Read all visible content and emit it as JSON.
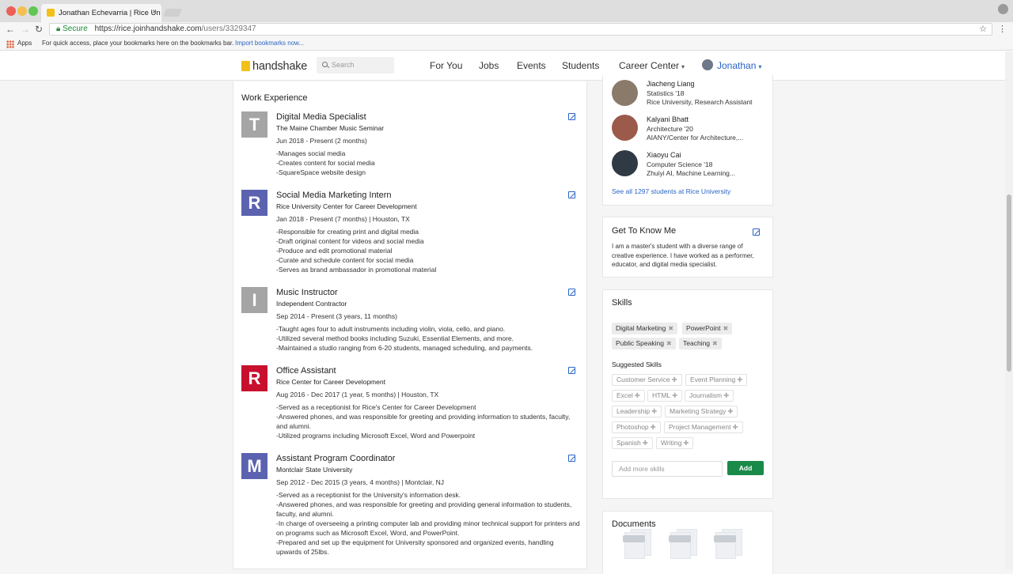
{
  "browser": {
    "tab_title": "Jonathan Echevarria | Rice Un",
    "tab_close": "×",
    "secure_label": "Secure",
    "url_host": "https://rice.joinhandshake.com",
    "url_path": "/users/3329347",
    "back": "←",
    "forward": "→",
    "reload": "↻",
    "star": "☆",
    "menu": "⋮",
    "bookmarks": {
      "apps_label": "Apps",
      "hint": "For quick access, place your bookmarks here on the bookmarks bar.",
      "import_link": "Import bookmarks now..."
    }
  },
  "header": {
    "logo": "handshake",
    "search_placeholder": "Search",
    "nav": [
      "For You",
      "Jobs",
      "Events",
      "Students",
      "Career Center"
    ],
    "user_name": "Jonathan",
    "caret": "▾"
  },
  "work_experience": {
    "title": "Work Experience",
    "jobs": [
      {
        "logo_letter": "T",
        "logo_color": "#a5a5a5",
        "title": "Digital Media Specialist",
        "org": "The Maine Chamber Music Seminar",
        "dates": "Jun 2018 - Present (2 months)",
        "description": [
          "-Manages social media",
          "-Creates content for social media",
          "-SquareSpace website design"
        ]
      },
      {
        "logo_letter": "R",
        "logo_color": "#5b63b0",
        "title": "Social Media Marketing Intern",
        "org": "Rice University Center for Career Development",
        "dates": "Jan 2018 - Present (7 months) | Houston, TX",
        "description": [
          "-Responsible for creating print and digital media",
          "-Draft original content for videos and social media",
          "-Produce and edit promotional material",
          "-Curate and schedule content for social media",
          "-Serves as brand ambassador in promotional material"
        ]
      },
      {
        "logo_letter": "I",
        "logo_color": "#a5a5a5",
        "title": "Music Instructor",
        "org": "Independent Contractor",
        "dates": "Sep 2014 - Present (3 years, 11 months)",
        "description": [
          "-Taught ages four to adult instruments including violin, viola, cello, and piano.",
          "-Utilized several method books including Suzuki, Essential Elements, and more.",
          "-Maintained a studio ranging from 6-20 students, managed scheduling, and payments."
        ]
      },
      {
        "logo_letter": "R",
        "logo_color": "#c8102e",
        "title": "Office Assistant",
        "org": "Rice Center for Career Development",
        "dates": "Aug 2016 - Dec 2017 (1 year, 5 months) | Houston, TX",
        "description": [
          "-Served as a receptionist for Rice's Center for Career Development",
          "-Answered phones, and was responsible for greeting and providing information to students, faculty, and alumni.",
          "-Utilized programs including Microsoft Excel, Word and Powerpoint"
        ]
      },
      {
        "logo_letter": "M",
        "logo_color": "#5b63b0",
        "title": "Assistant Program Coordinator",
        "org": "Montclair State University",
        "dates": "Sep 2012 - Dec 2015 (3 years, 4 months) | Montclair, NJ",
        "description": [
          "-Served as a receptionist for the University's information desk.",
          "-Answered phones, and was responsible for greeting and providing general information to students, faculty, and alumni.",
          "-In charge of overseeing a printing computer lab and providing minor technical support for printers and on programs such as Microsoft Excel, Word, and PowerPoint.",
          "-Prepared and set up the equipment for University sponsored and organized events, handling upwards of 25lbs."
        ]
      }
    ]
  },
  "students": {
    "items": [
      {
        "name": "Jiacheng Liang",
        "line1": "Statistics '18",
        "line2": "Rice University, Research Assistant",
        "avatar_color": "#8a7a6a"
      },
      {
        "name": "Kalyani Bhatt",
        "line1": "Architecture '20",
        "line2": "AIANY/Center for Architecture,...",
        "avatar_color": "#9b5a4a"
      },
      {
        "name": "Xiaoyu Cai",
        "line1": "Computer Science '18",
        "line2": "Zhuiyi AI, Machine Learning...",
        "avatar_color": "#2f3a44"
      }
    ],
    "see_all": "See all 1297 students at Rice University"
  },
  "get_to_know": {
    "title": "Get To Know Me",
    "text": "I am a master's student with a diverse range of creative experience. I have worked as a performer, educator, and digital media specialist."
  },
  "skills": {
    "title": "Skills",
    "remove_glyph": "✖",
    "add_glyph": "✚",
    "tags": [
      "Digital Marketing",
      "PowerPoint",
      "Public Speaking",
      "Teaching"
    ],
    "suggested_title": "Suggested Skills",
    "suggested": [
      "Customer Service",
      "Event Planning",
      "Excel",
      "HTML",
      "Journalism",
      "Leadership",
      "Marketing Strategy",
      "Photoshop",
      "Project Management",
      "Spanish",
      "Writing"
    ],
    "input_placeholder": "Add more skills",
    "add_label": "Add"
  },
  "documents": {
    "title": "Documents"
  },
  "colors": {
    "link": "#2a64c4",
    "add_button": "#1a8a48",
    "brand": "#f2c018"
  }
}
